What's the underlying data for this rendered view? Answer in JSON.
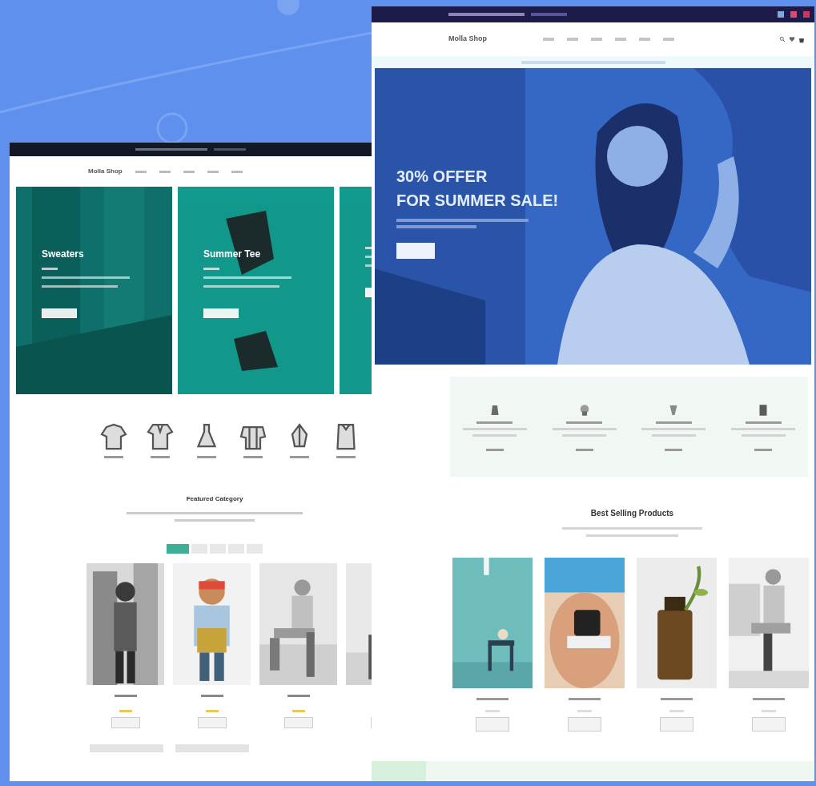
{
  "left_page": {
    "logo": "Molla Shop",
    "banners": [
      {
        "kind": "full",
        "title": "Sweaters"
      },
      {
        "kind": "full",
        "title": "Summer Tee"
      },
      {
        "kind": "cut_off"
      }
    ],
    "section_title": "Featured Category",
    "filter_tabs": [
      {
        "selected": true
      },
      {
        "selected": false
      },
      {
        "selected": false
      },
      {
        "selected": false
      },
      {
        "selected": false
      }
    ]
  },
  "right_page": {
    "logo": "Molla Shop",
    "hero": {
      "title_lines": [
        "30% OFFER",
        "FOR SUMMER SALE!"
      ]
    },
    "section_title": "Best Selling Products"
  }
}
